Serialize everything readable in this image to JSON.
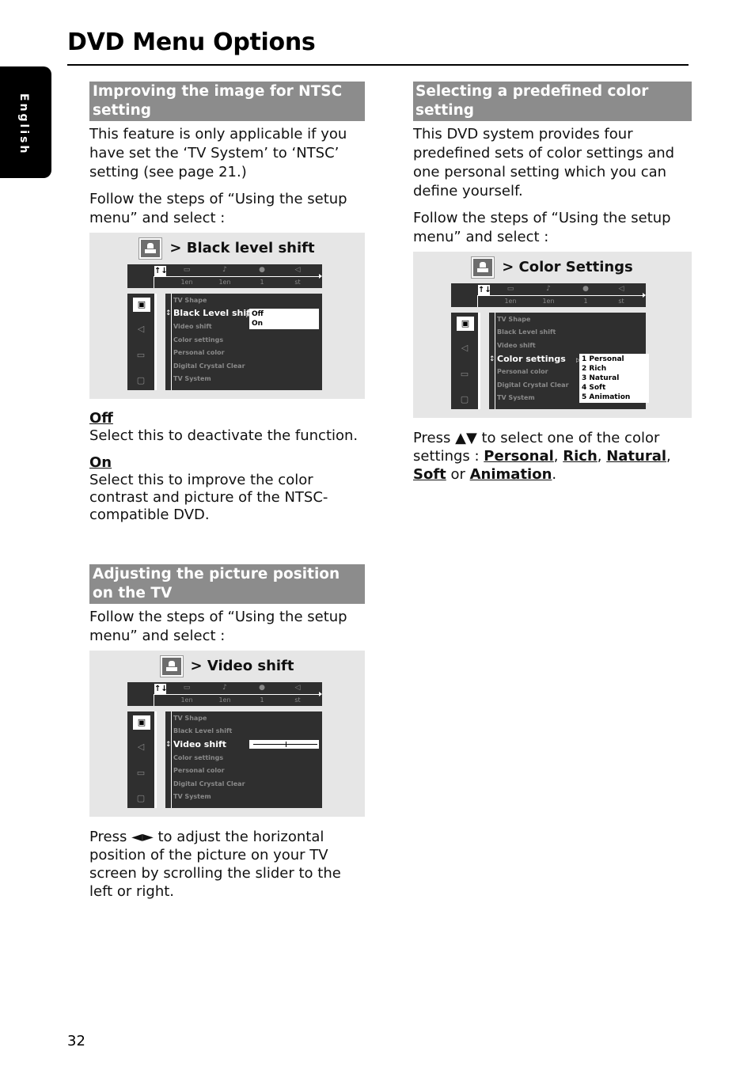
{
  "page": {
    "title": "DVD Menu Options",
    "language_tab": "English",
    "page_number": "32"
  },
  "menu_common": {
    "topbar_icons": [
      "setup-icon",
      "subtitle-icon",
      "audio-icon",
      "disc-icon",
      "speaker-icon"
    ],
    "topbar_selected_glyph": "↑↓",
    "topbar_values": [
      "1en",
      "1en",
      "1",
      "st"
    ],
    "sidebar_icons": [
      "picture-icon",
      "sound-icon",
      "language-icon",
      "features-icon"
    ],
    "items": [
      "TV Shape",
      "Black Level shift",
      "Video shift",
      "Color settings",
      "Personal color",
      "Digital Crystal Clear",
      "TV System"
    ]
  },
  "ntsc": {
    "heading": "Improving the image for NTSC setting",
    "intro": "This feature is only applicable if you have set the ‘TV System’ to ‘NTSC’ setting (see page 21.)",
    "follow": "Follow the steps of “Using the setup menu” and select :",
    "panel_label": ">  Black level shift",
    "active_item": "Black Level shift",
    "options": [
      "Off",
      "On"
    ],
    "off_term": "Off",
    "off_desc": "Select this to deactivate the function.",
    "on_term": "On",
    "on_desc": "Select this to improve the color contrast and picture of the NTSC-compatible DVD."
  },
  "position": {
    "heading": "Adjusting the picture position on the TV",
    "follow": "Follow the steps of “Using the setup menu” and select :",
    "panel_label": ">  Video shift",
    "active_item": "Video shift",
    "slider_value_fraction": 0.5,
    "press_prefix": "Press ◄► to adjust the horizontal position of the picture on your TV screen by scrolling the slider to the left or right."
  },
  "color": {
    "heading": "Selecting a predefined color setting",
    "intro": "This DVD system provides four predefined sets of color settings and one personal setting which you can define yourself.",
    "follow": "Follow the steps of “Using the setup menu” and select :",
    "panel_label": ">  Color Settings",
    "active_item": "Color settings",
    "options": [
      "1  Personal",
      "2  Rich",
      "3  Natural",
      "4  Soft",
      "5  Animation"
    ],
    "press_text_1": "Press ▲▼ to select one of the color settings : ",
    "terms": [
      "Personal",
      "Rich",
      "Natural",
      "Soft",
      "Animation"
    ],
    "sep_comma": ", ",
    "sep_or": " or ",
    "end": "."
  }
}
